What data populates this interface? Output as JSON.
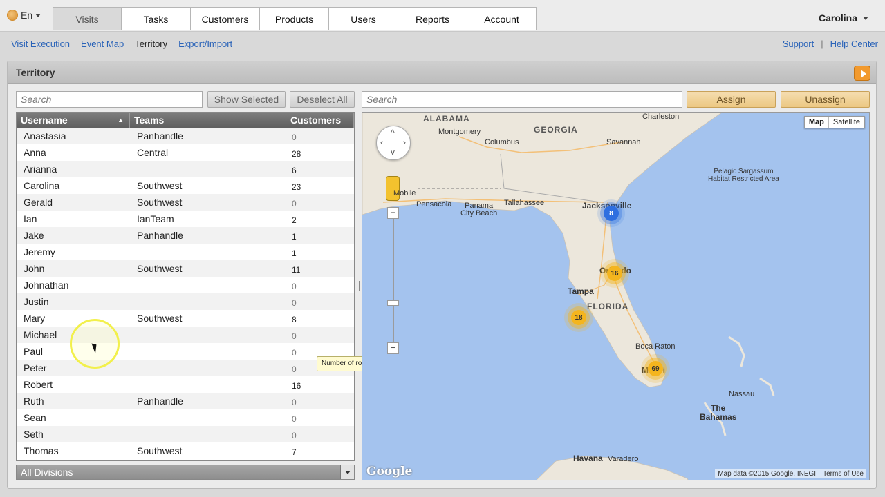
{
  "header": {
    "language": "En",
    "tabs": [
      {
        "label": "Visits",
        "active": true
      },
      {
        "label": "Tasks",
        "active": false
      },
      {
        "label": "Customers",
        "active": false
      },
      {
        "label": "Products",
        "active": false
      },
      {
        "label": "Users",
        "active": false
      },
      {
        "label": "Reports",
        "active": false
      },
      {
        "label": "Account",
        "active": false
      }
    ],
    "user": "Carolina"
  },
  "subnav": {
    "links": [
      "Visit Execution",
      "Event Map",
      "Territory",
      "Export/Import"
    ],
    "current": "Territory",
    "support": "Support",
    "separator": "|",
    "help": "Help Center"
  },
  "panel": {
    "title": "Territory",
    "left_search_placeholder": "Search",
    "show_selected": "Show Selected",
    "deselect_all": "Deselect All",
    "right_search_placeholder": "Search",
    "assign": "Assign",
    "unassign": "Unassign",
    "divisions": "All Divisions",
    "tooltip": "Number of rows"
  },
  "table": {
    "columns": [
      "Username",
      "Teams",
      "Customers"
    ],
    "sort_indicator": "▲",
    "rows": [
      {
        "username": "Anastasia",
        "team": "Panhandle",
        "customers": "0"
      },
      {
        "username": "Anna",
        "team": "Central",
        "customers": "28"
      },
      {
        "username": "Arianna",
        "team": "",
        "customers": "6"
      },
      {
        "username": "Carolina",
        "team": "Southwest",
        "customers": "23"
      },
      {
        "username": "Gerald",
        "team": "Southwest",
        "customers": "0"
      },
      {
        "username": "Ian",
        "team": "IanTeam",
        "customers": "2"
      },
      {
        "username": "Jake",
        "team": "Panhandle",
        "customers": "1"
      },
      {
        "username": "Jeremy",
        "team": "",
        "customers": "1"
      },
      {
        "username": "John",
        "team": "Southwest",
        "customers": "11"
      },
      {
        "username": "Johnathan",
        "team": "",
        "customers": "0"
      },
      {
        "username": "Justin",
        "team": "",
        "customers": "0"
      },
      {
        "username": "Mary",
        "team": "Southwest",
        "customers": "8"
      },
      {
        "username": "Michael",
        "team": "",
        "customers": "0"
      },
      {
        "username": "Paul",
        "team": "",
        "customers": "0"
      },
      {
        "username": "Peter",
        "team": "",
        "customers": "0"
      },
      {
        "username": "Robert",
        "team": "",
        "customers": "16"
      },
      {
        "username": "Ruth",
        "team": "Panhandle",
        "customers": "0"
      },
      {
        "username": "Sean",
        "team": "",
        "customers": "0"
      },
      {
        "username": "Seth",
        "team": "",
        "customers": "0"
      },
      {
        "username": "Thomas",
        "team": "Southwest",
        "customers": "7"
      }
    ]
  },
  "map": {
    "type_map": "Map",
    "type_satellite": "Satellite",
    "zoom_in": "+",
    "zoom_out": "−",
    "google": "Google",
    "attribution": "Map data ©2015 Google, INEGI",
    "terms": "Terms of Use",
    "clusters": [
      {
        "count": "8",
        "color": "blue"
      },
      {
        "count": "16",
        "color": "orange"
      },
      {
        "count": "18",
        "color": "orange"
      },
      {
        "count": "69",
        "color": "orange"
      }
    ],
    "labels": {
      "alabama": "ALABAMA",
      "georgia": "GEORGIA",
      "florida": "FLORIDA",
      "montgomery": "Montgomery",
      "columbus": "Columbus",
      "charleston": "Charleston",
      "savannah": "Savannah",
      "mobile": "Mobile",
      "pensacola": "Pensacola",
      "panama_city": "Panama\nCity Beach",
      "tallahassee": "Tallahassee",
      "jacksonville": "Jacksonville",
      "orlando": "Orlando",
      "tampa": "Tampa",
      "boca_raton": "Boca Raton",
      "miami": "Miami",
      "nassau": "Nassau",
      "bahamas": "The\nBahamas",
      "havana": "Havana",
      "varadero": "Varadero",
      "sargassum": "Pelagic Sargassum\nHabitat Restricted Area"
    }
  },
  "colors": {
    "link": "#2a63b8",
    "water": "#a4c3ee",
    "land": "#ece7dc",
    "cluster_blue": "#2f6fe0",
    "cluster_orange": "#f4b51e",
    "button_orange": "#ecc883"
  }
}
